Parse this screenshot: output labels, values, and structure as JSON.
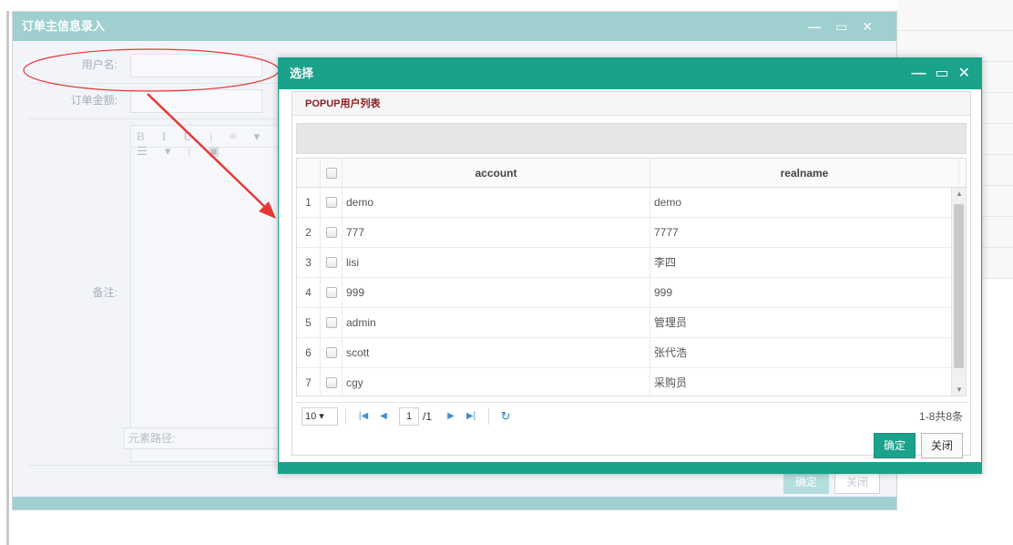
{
  "back_dialog": {
    "title": "订单主信息录入",
    "controls": "— ▭ ✕",
    "fields": {
      "username_label": "用户名:",
      "amount_label": "订单金额:",
      "remark_label": "备注:"
    },
    "editor_tools": "B I U | ≡ ▾ ☰ ▾ | ▣",
    "editor_path_label": "元素路径:",
    "ok_label": "确定",
    "close_label": "关闭"
  },
  "popup": {
    "title": "选择",
    "panel_title": "POPUP用户列表",
    "columns": {
      "account": "account",
      "realname": "realname"
    },
    "rows": [
      {
        "num": "1",
        "account": "demo",
        "realname": "demo"
      },
      {
        "num": "2",
        "account": "777",
        "realname": "7777"
      },
      {
        "num": "3",
        "account": "lisi",
        "realname": "李四"
      },
      {
        "num": "4",
        "account": "999",
        "realname": "999"
      },
      {
        "num": "5",
        "account": "admin",
        "realname": "管理员"
      },
      {
        "num": "6",
        "account": "scott",
        "realname": "张代浩"
      },
      {
        "num": "7",
        "account": "cgy",
        "realname": "采购员"
      }
    ],
    "pager": {
      "page_size": "10",
      "current_page": "1",
      "total_pages": "/1",
      "info": "1-8共8条"
    },
    "ok_label": "确定",
    "close_label": "关闭"
  },
  "colors": {
    "popup_accent": "#1aa28a",
    "back_accent": "#9fcfcf",
    "annotation": "#e53935"
  }
}
